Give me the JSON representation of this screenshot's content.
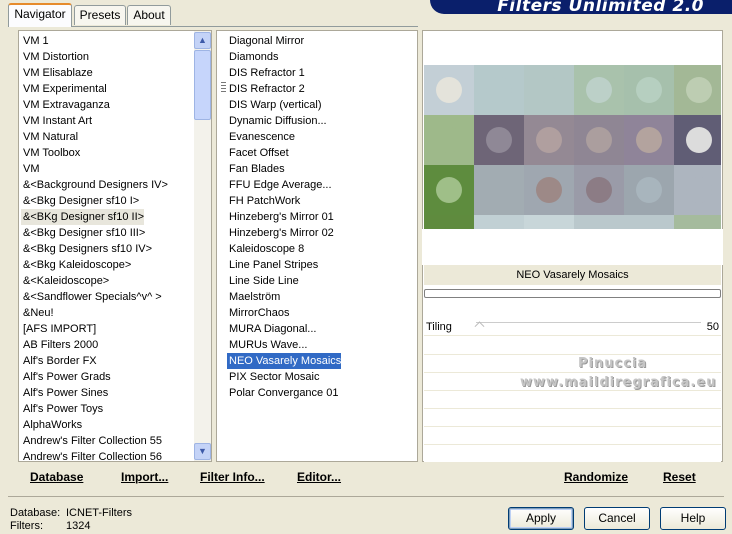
{
  "tabs": [
    {
      "label": "Navigator",
      "active": true
    },
    {
      "label": "Presets",
      "active": false
    },
    {
      "label": "About",
      "active": false
    }
  ],
  "header": {
    "title": "Filters Unlimited 2.0"
  },
  "categories": [
    "VM 1",
    "VM Distortion",
    "VM Elisablaze",
    "VM Experimental",
    "VM Extravaganza",
    "VM Instant Art",
    "VM Natural",
    "VM Toolbox",
    "VM",
    "&<Background Designers IV>",
    "&<Bkg Designer sf10 I>",
    "&<BKg Designer sf10 II>",
    "&<Bkg Designer sf10 III>",
    "&<Bkg Designers sf10 IV>",
    "&<Bkg Kaleidoscope>",
    "&<Kaleidoscope>",
    "&<Sandflower Specials^v^ >",
    "&Neu!",
    "[AFS IMPORT]",
    "AB Filters 2000",
    "Alf's Border FX",
    "Alf's Power Grads",
    "Alf's Power Sines",
    "Alf's Power Toys",
    "AlphaWorks",
    "Andrew's Filter Collection 55",
    "Andrew's Filter Collection 56"
  ],
  "selected_category": "&<BKg Designer sf10 II>",
  "filters": [
    "Diagonal Mirror",
    "Diamonds",
    "DIS Refractor 1",
    "DIS Refractor 2",
    "DIS Warp (vertical)",
    "Dynamic Diffusion...",
    "Evanescence",
    "Facet Offset",
    "Fan Blades",
    "FFU Edge Average...",
    "FH PatchWork",
    "Hinzeberg's Mirror 01",
    "Hinzeberg's Mirror 02",
    "Kaleidoscope 8",
    "Line Panel Stripes",
    "Line Side Line",
    "Maelström",
    "MirrorChaos",
    "MURA Diagonal...",
    "MURUs Wave...",
    "NEO Vasarely Mosaics",
    "PIX Sector Mosaic",
    "Polar Convergance 01"
  ],
  "selected_filter": "NEO Vasarely Mosaics",
  "left_buttons": {
    "database": "Database",
    "import": "Import...",
    "filter_info": "Filter Info...",
    "editor": "Editor..."
  },
  "preview": {
    "filter_name": "NEO Vasarely Mosaics",
    "params": [
      {
        "label": "Tiling",
        "value": "50"
      }
    ],
    "cells": [
      [
        "#c3cfd6",
        "#b5c9cb",
        "#b3c7c5",
        "#a9c2ac",
        "#a6c0ac",
        "#a3b896"
      ],
      [
        "#9eb98a",
        "#6e6577",
        "#948994",
        "#8f8694",
        "#8f8499",
        "#605d75"
      ],
      [
        "#5e8c3e",
        "#a2acb2",
        "#9fa7b0",
        "#9a9ba8",
        "#9ca6ae",
        "#adb5bf"
      ],
      [
        "#5f8b3e",
        "#c1d0d4",
        "#c8d6d9",
        "#bac8cc",
        "#bac8cc",
        "#a5bb9d"
      ]
    ],
    "dots": [
      [
        "#e4e3db",
        "#b5c9cb",
        "#b3c7c5",
        "#bcd0c8",
        "#b6cfc0",
        "#bdcdb2"
      ],
      [
        "#9eb98a",
        "#8f8896",
        "#b09f9f",
        "#ab9e9e",
        "#b3a39e",
        "#dcdcdc"
      ],
      [
        "#9fbf88",
        "#a2acb2",
        "#9d8987",
        "#8c7c85",
        "#a8b5bd",
        "#adb5bf"
      ],
      [
        "#5f8b3e",
        "#c1d0d4",
        "#c8d6d9",
        "#bac8cc",
        "#bac8cc",
        "#a5bb9d"
      ]
    ],
    "watermark_line1": "Pinuccia",
    "watermark_line2": "www.maildiregrafica.eu"
  },
  "right_buttons": {
    "randomize": "Randomize",
    "reset": "Reset"
  },
  "status": {
    "database_label": "Database:",
    "database_value": "ICNET-Filters",
    "filters_label": "Filters:",
    "filters_value": "1324"
  },
  "dialog_buttons": {
    "apply": "Apply",
    "cancel": "Cancel",
    "help": "Help"
  }
}
